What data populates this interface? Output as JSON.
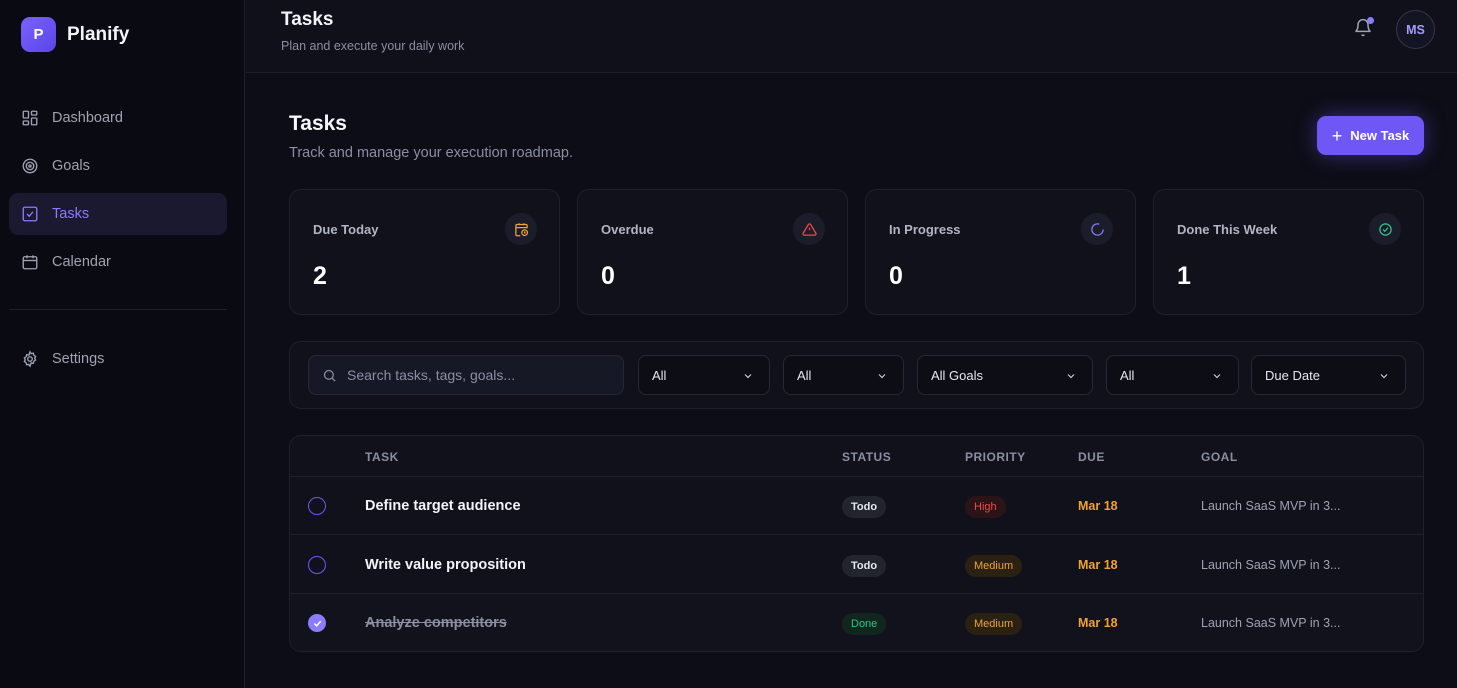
{
  "brand": {
    "logo_letter": "P",
    "name": "Planify"
  },
  "sidebar": {
    "items": [
      {
        "label": "Dashboard",
        "icon": "grid-icon"
      },
      {
        "label": "Goals",
        "icon": "target-icon"
      },
      {
        "label": "Tasks",
        "icon": "checkbox-icon",
        "active": true
      },
      {
        "label": "Calendar",
        "icon": "calendar-icon"
      }
    ],
    "settings_label": "Settings"
  },
  "header": {
    "title": "Tasks",
    "subtitle": "Plan and execute your daily work",
    "avatar_initials": "MS"
  },
  "main": {
    "title": "Tasks",
    "subtitle": "Track and manage your execution roadmap.",
    "new_task_label": "New Task"
  },
  "stats": [
    {
      "label": "Due Today",
      "value": "2",
      "icon": "calendar-clock-icon",
      "color": "#f0a236"
    },
    {
      "label": "Overdue",
      "value": "0",
      "icon": "warning-triangle-icon",
      "color": "#f24848"
    },
    {
      "label": "In Progress",
      "value": "0",
      "icon": "spinner-icon",
      "color": "#8b7bff"
    },
    {
      "label": "Done This Week",
      "value": "1",
      "icon": "check-circle-icon",
      "color": "#34c38a"
    }
  ],
  "filters": {
    "search_placeholder": "Search tasks, tags, goals...",
    "selects": [
      "All",
      "All",
      "All Goals",
      "All",
      "Due Date"
    ]
  },
  "table": {
    "headers": {
      "task": "TASK",
      "status": "STATUS",
      "priority": "PRIORITY",
      "due": "DUE",
      "goal": "GOAL"
    },
    "rows": [
      {
        "task": "Define target audience",
        "status": "Todo",
        "priority": "High",
        "due": "Mar 18",
        "goal": "Launch SaaS MVP in 3...",
        "done": false
      },
      {
        "task": "Write value proposition",
        "status": "Todo",
        "priority": "Medium",
        "due": "Mar 18",
        "goal": "Launch SaaS MVP in 3...",
        "done": false
      },
      {
        "task": "Analyze competitors",
        "status": "Done",
        "priority": "Medium",
        "due": "Mar 18",
        "goal": "Launch SaaS MVP in 3...",
        "done": true
      }
    ]
  },
  "colors": {
    "accent": "#6e57f5",
    "background": "#0c0d16",
    "warning": "#f0a236",
    "danger": "#f24848",
    "success": "#34c38a"
  }
}
